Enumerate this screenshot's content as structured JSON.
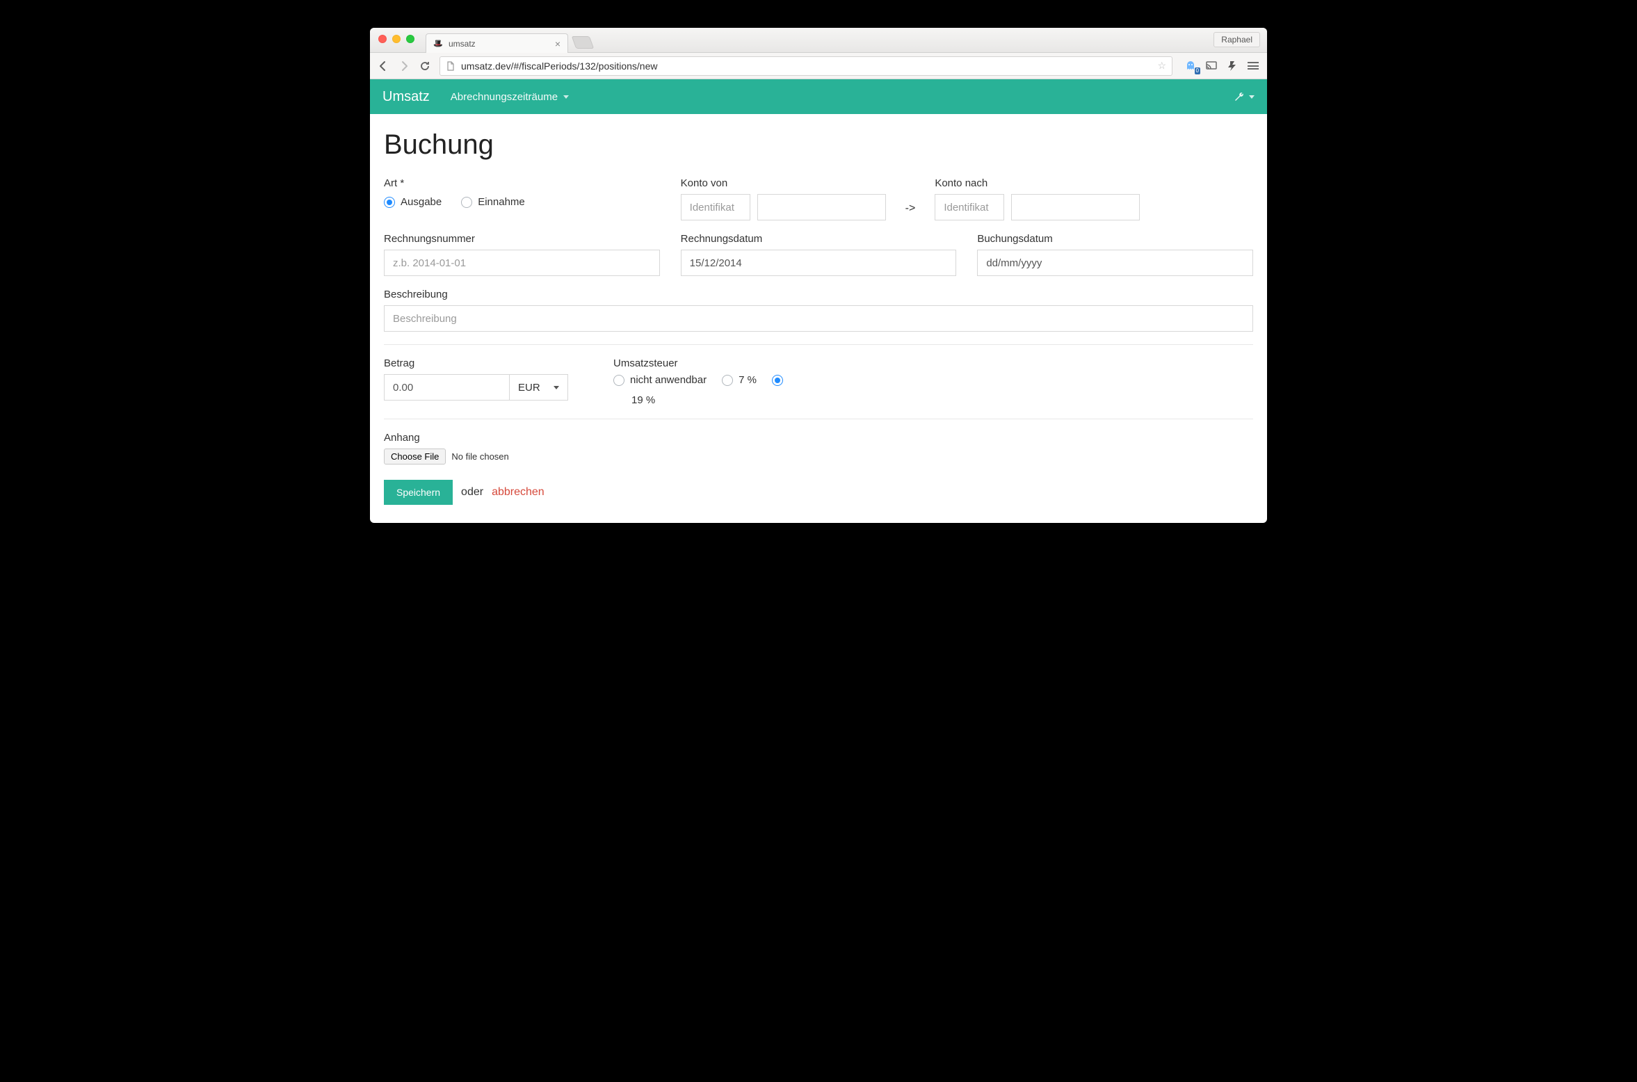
{
  "browser": {
    "tab_title": "umsatz",
    "profile_button": "Raphael",
    "url": "umsatz.dev/#/fiscalPeriods/132/positions/new",
    "ghostery_badge": "0"
  },
  "header": {
    "brand": "Umsatz",
    "nav_item": "Abrechnungszeiträume"
  },
  "page": {
    "title": "Buchung",
    "art": {
      "label": "Art *",
      "options": {
        "ausgabe": "Ausgabe",
        "einnahme": "Einnahme"
      },
      "selected": "ausgabe"
    },
    "konto_von": {
      "label": "Konto von",
      "placeholder_id": "Identifikat"
    },
    "arrow": "->",
    "konto_nach": {
      "label": "Konto nach",
      "placeholder_id": "Identifikat"
    },
    "rechnungsnummer": {
      "label": "Rechnungsnummer",
      "placeholder": "z.b. 2014-01-01"
    },
    "rechnungsdatum": {
      "label": "Rechnungsdatum",
      "value": "15/12/2014"
    },
    "buchungsdatum": {
      "label": "Buchungsdatum",
      "value": "dd/mm/yyyy"
    },
    "beschreibung": {
      "label": "Beschreibung",
      "placeholder": "Beschreibung"
    },
    "betrag": {
      "label": "Betrag",
      "value": "0.00",
      "currency": "EUR"
    },
    "umsatzsteuer": {
      "label": "Umsatzsteuer",
      "options": {
        "na": "nicht anwendbar",
        "seven": "7 %",
        "nineteen": "19 %"
      },
      "selected": "nineteen"
    },
    "anhang": {
      "label": "Anhang",
      "choose": "Choose File",
      "status": "No file chosen"
    },
    "actions": {
      "save": "Speichern",
      "or": "oder",
      "cancel": "abbrechen"
    }
  }
}
